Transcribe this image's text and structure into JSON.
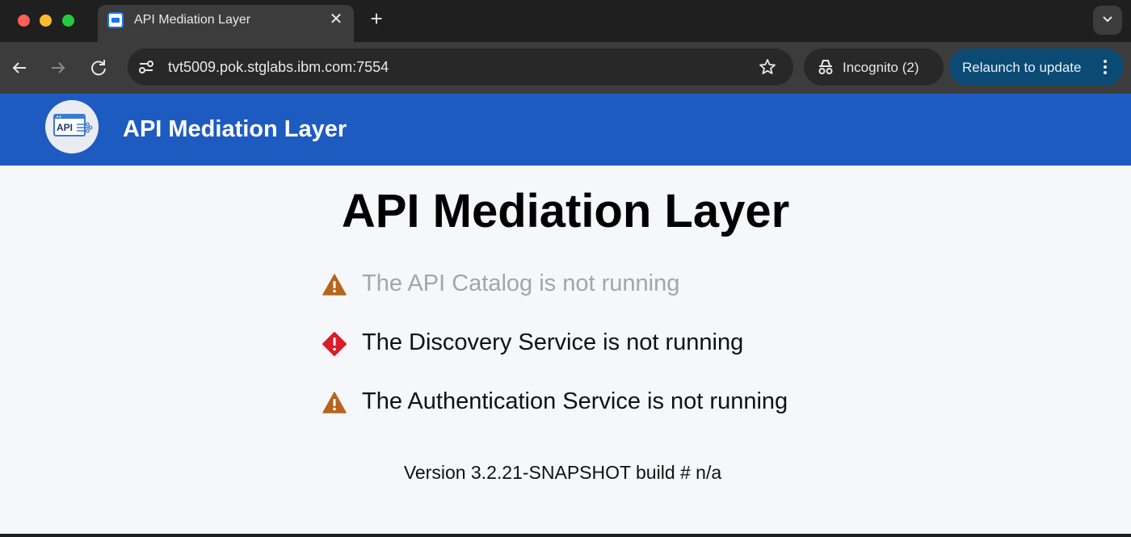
{
  "browser": {
    "tab": {
      "title": "API Mediation Layer",
      "favicon": "api-favicon-icon"
    },
    "url": "tvt5009.pok.stglabs.ibm.com:7554",
    "incognito_label": "Incognito (2)",
    "relaunch_label": "Relaunch to update"
  },
  "app": {
    "header_title": "API Mediation Layer",
    "page_title": "API Mediation Layer",
    "statuses": [
      {
        "text": "The API Catalog is not running",
        "icon": "warning-icon",
        "color": "#a5a5a5"
      },
      {
        "text": "The Discovery Service is not running",
        "icon": "error-icon",
        "color": "#111111"
      },
      {
        "text": "The Authentication Service is not running",
        "icon": "warning-icon",
        "color": "#111111"
      }
    ],
    "version": "Version 3.2.21-SNAPSHOT build # n/a"
  },
  "colors": {
    "header_bg": "#1e5bc1",
    "warning": "#b5651d",
    "error": "#da1e28",
    "relaunch_bg": "#0b4a73"
  }
}
